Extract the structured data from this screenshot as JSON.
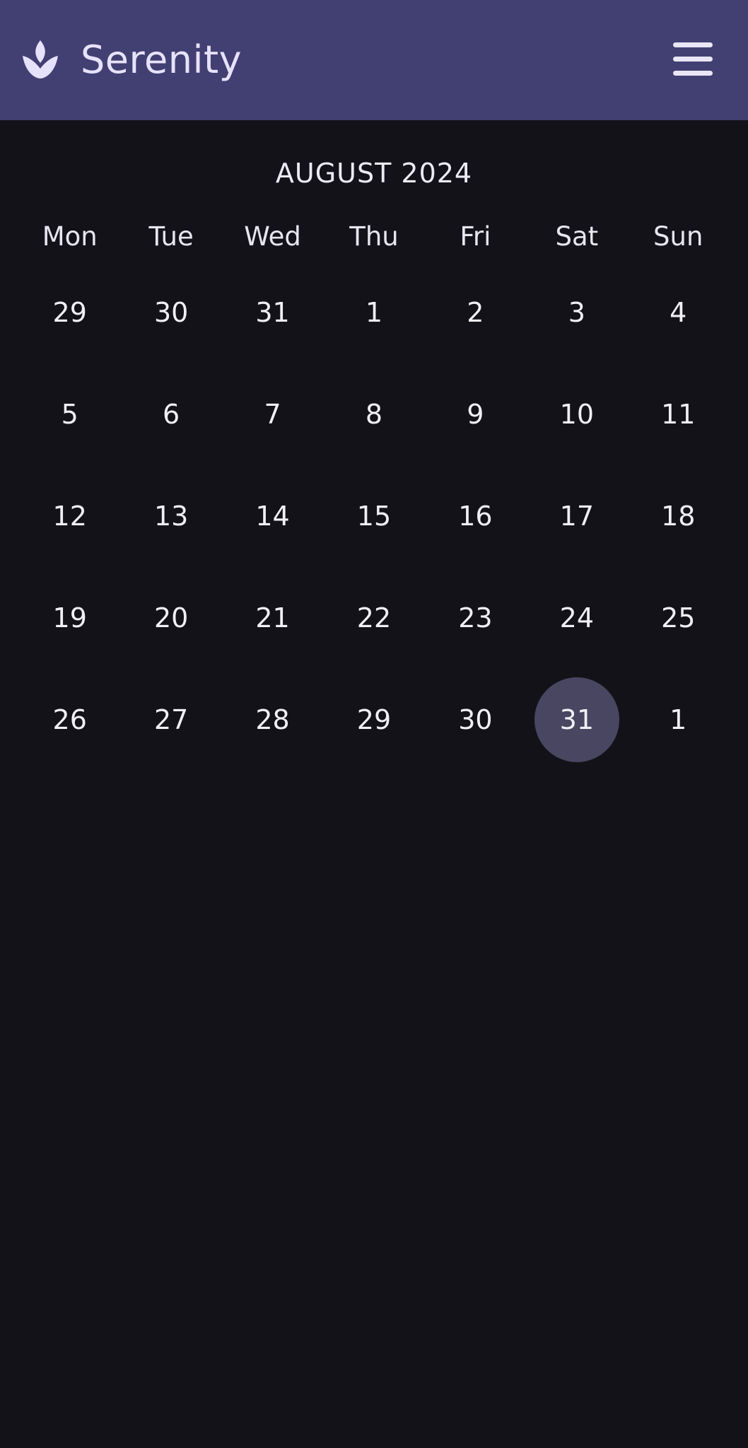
{
  "header": {
    "app_title": "Serenity",
    "logo_icon": "lotus-icon",
    "menu_icon": "hamburger-menu-icon",
    "background": "#423f72"
  },
  "calendar": {
    "month_label": "AUGUST 2024",
    "weekdays": [
      "Mon",
      "Tue",
      "Wed",
      "Thu",
      "Fri",
      "Sat",
      "Sun"
    ],
    "weeks": [
      [
        "29",
        "30",
        "31",
        "1",
        "2",
        "3",
        "4"
      ],
      [
        "5",
        "6",
        "7",
        "8",
        "9",
        "10",
        "11"
      ],
      [
        "12",
        "13",
        "14",
        "15",
        "16",
        "17",
        "18"
      ],
      [
        "19",
        "20",
        "21",
        "22",
        "23",
        "24",
        "25"
      ],
      [
        "26",
        "27",
        "28",
        "29",
        "30",
        "31",
        "1"
      ]
    ],
    "selected_day": "31",
    "selected_color": "#484660",
    "background": "#131218"
  }
}
